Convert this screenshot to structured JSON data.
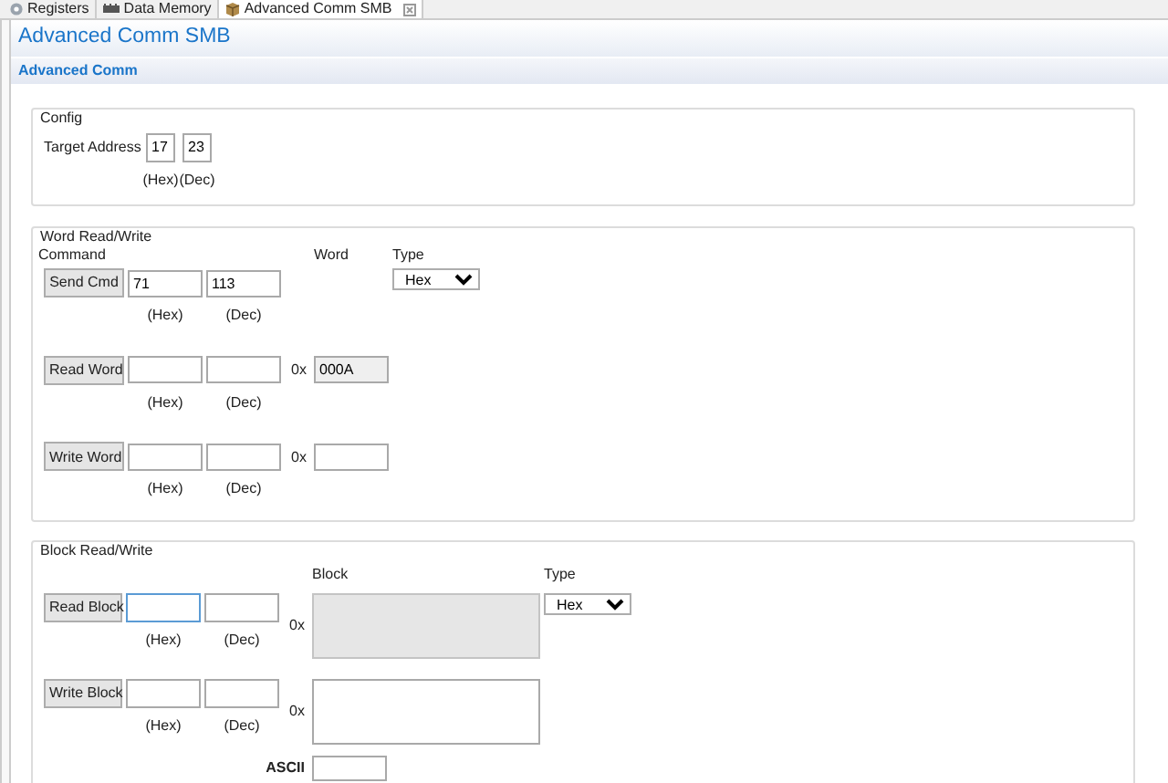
{
  "tabs": [
    {
      "label": "Registers",
      "selected": false
    },
    {
      "label": "Data Memory",
      "selected": false
    },
    {
      "label": "Advanced Comm SMB",
      "selected": true
    }
  ],
  "editor_title": "Advanced Comm SMB",
  "section_title": "Advanced Comm",
  "config": {
    "title": "Config",
    "label": "Target Address",
    "hex": "17",
    "dec": "23",
    "hex_caption": "(Hex)",
    "dec_caption": "(Dec)"
  },
  "word": {
    "title": "Word Read/Write",
    "command_label": "Command",
    "word_label": "Word",
    "type_label": "Type",
    "type_value": "Hex",
    "rows": [
      {
        "button": "Send Cmd",
        "hex": {
          "value": "71"
        },
        "dec": {
          "value": "113"
        },
        "hex_caption": "(Hex)",
        "dec_caption": "(Dec)"
      },
      {
        "button": "Read Word",
        "hex": {},
        "dec": {},
        "hex_caption": "(Hex)",
        "dec_caption": "(Dec)",
        "prefix": "0x",
        "word_field": {
          "value": "000A",
          "disabled": true
        }
      },
      {
        "button": "Write Word",
        "hex": {},
        "dec": {},
        "hex_caption": "(Hex)",
        "dec_caption": "(Dec)",
        "prefix": "0x",
        "word_field": {
          "disabled": false
        }
      }
    ]
  },
  "block": {
    "title": "Block Read/Write",
    "block_label": "Block",
    "type_label": "Type",
    "type_value": "Hex",
    "rows": [
      {
        "button": "Read Block",
        "hex": {
          "focused": true
        },
        "dec": {},
        "hex_caption": "(Hex)",
        "dec_caption": "(Dec)",
        "prefix": "0x",
        "block_field": {
          "disabled": true
        }
      },
      {
        "button": "Write Block",
        "hex": {
          "focused": false
        },
        "dec": {},
        "hex_caption": "(Hex)",
        "dec_caption": "(Dec)",
        "prefix": "0x",
        "block_field": {
          "disabled": false
        }
      }
    ],
    "ascii_label": "ASCII"
  }
}
